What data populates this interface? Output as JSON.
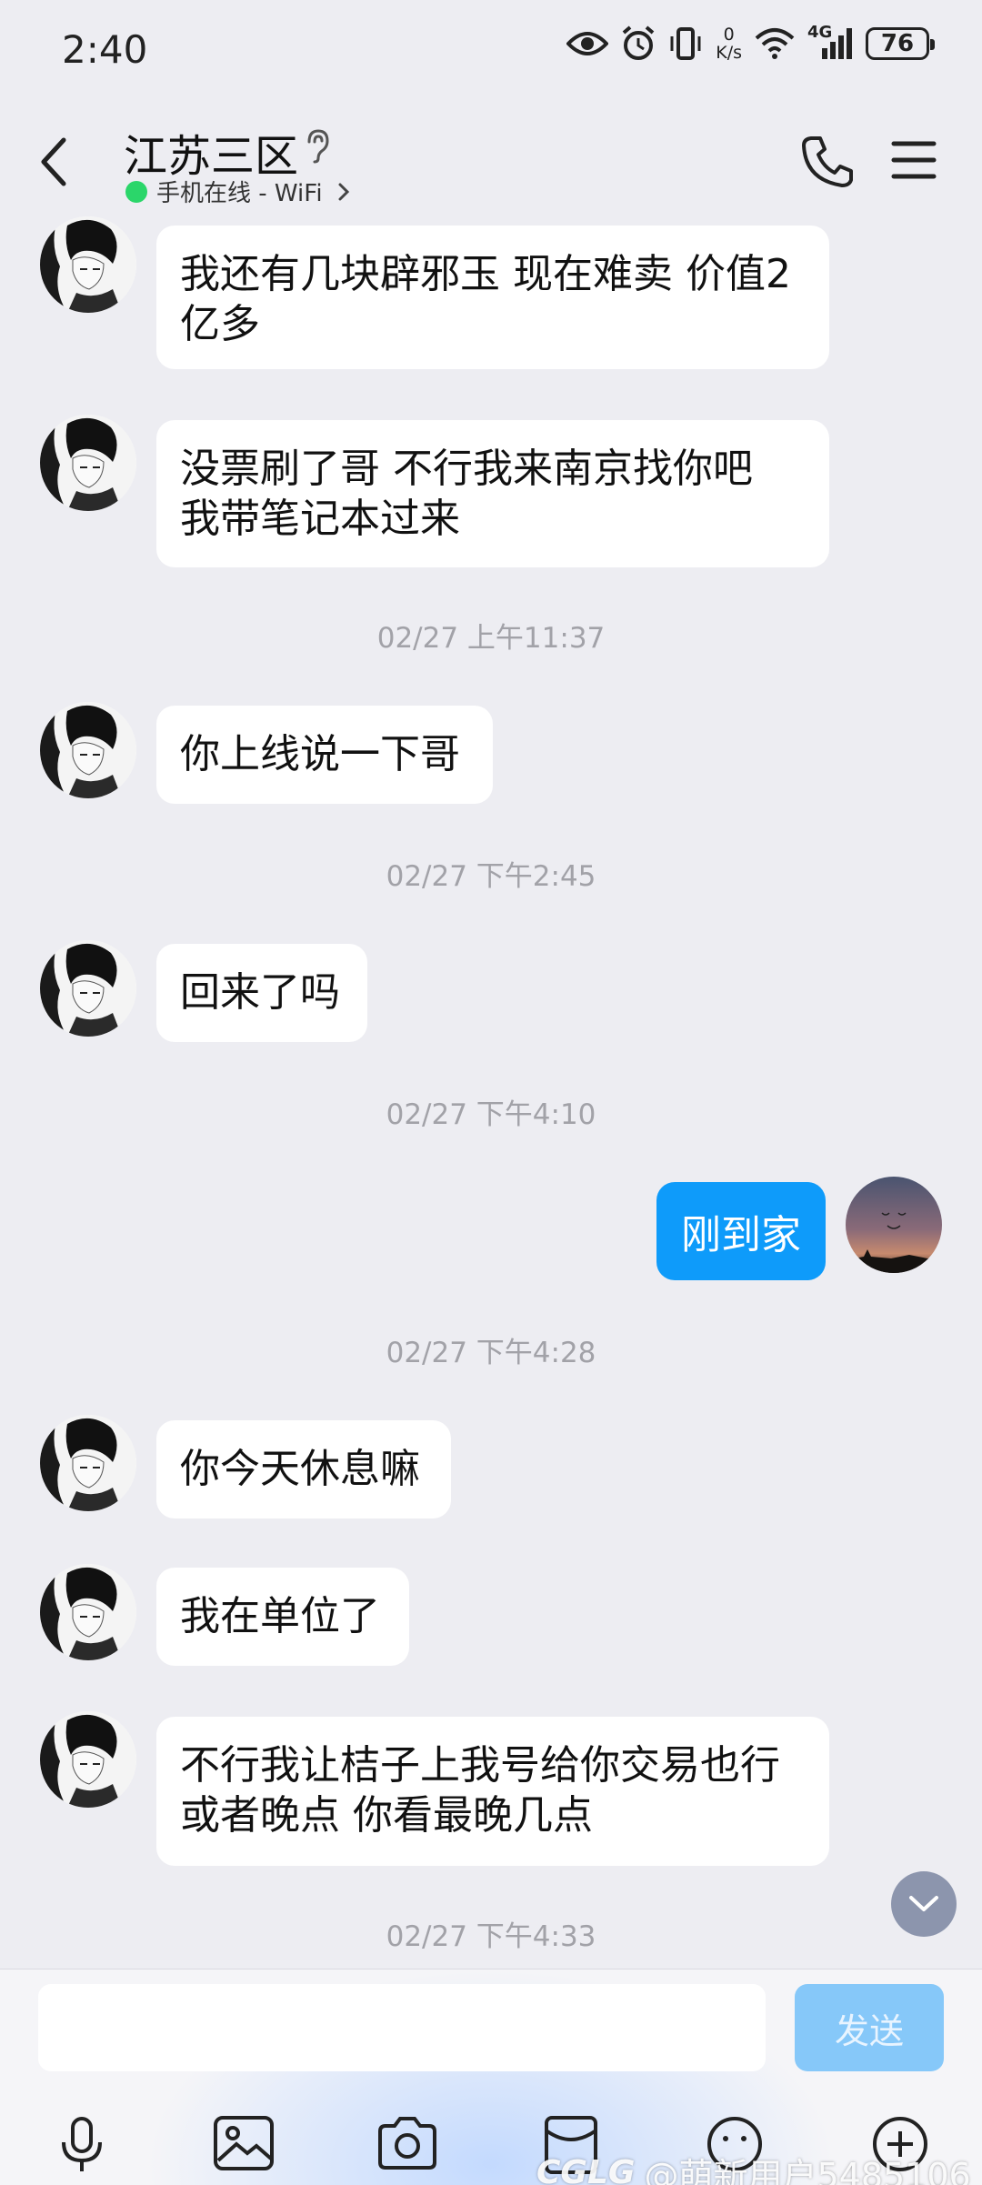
{
  "status_bar": {
    "time": "2:40",
    "net_speed_value": "0",
    "net_speed_unit": "K/s",
    "network_type": "4G",
    "battery": "76"
  },
  "header": {
    "title": "江苏三区",
    "presence": "手机在线 - WiFi"
  },
  "messages": [
    {
      "type": "in",
      "text_line1": "我还有几块辟邪玉 现在难卖 价值2",
      "text_line2": "亿多"
    },
    {
      "type": "in",
      "text_line1": "没票刷了哥 不行我来南京找你吧",
      "text_line2": "我带笔记本过来"
    },
    {
      "type": "time",
      "text": "02/27 上午11:37"
    },
    {
      "type": "in",
      "text_line1": "你上线说一下哥"
    },
    {
      "type": "time",
      "text": "02/27 下午2:45"
    },
    {
      "type": "in",
      "text_line1": "回来了吗"
    },
    {
      "type": "time",
      "text": "02/27 下午4:10"
    },
    {
      "type": "out",
      "text_line1": "刚到家"
    },
    {
      "type": "time",
      "text": "02/27 下午4:28"
    },
    {
      "type": "in",
      "text_line1": "你今天休息嘛"
    },
    {
      "type": "in",
      "text_line1": "我在单位了"
    },
    {
      "type": "in",
      "text_line1": "不行我让桔子上我号给你交易也行",
      "text_line2": "或者晚点 你看最晚几点"
    },
    {
      "type": "time",
      "text": "02/27 下午4:33"
    }
  ],
  "input": {
    "value": "",
    "send_label": "发送"
  },
  "watermark": {
    "logo": "CGLG",
    "text": "@萌新用户5485106"
  },
  "colors": {
    "background": "#EDEDF2",
    "outgoing_bubble": "#0E9BFA",
    "online_dot": "#2BD66A",
    "send_button": "#86C8F9"
  },
  "icons": [
    "eye-icon",
    "alarm-icon",
    "vibrate-icon",
    "wifi-icon",
    "signal-icon",
    "battery-icon",
    "back-icon",
    "ear-icon",
    "phone-icon",
    "menu-icon",
    "scroll-down-icon",
    "microphone-icon",
    "image-icon",
    "camera-icon",
    "red-packet-icon",
    "emoji-icon",
    "plus-icon"
  ]
}
